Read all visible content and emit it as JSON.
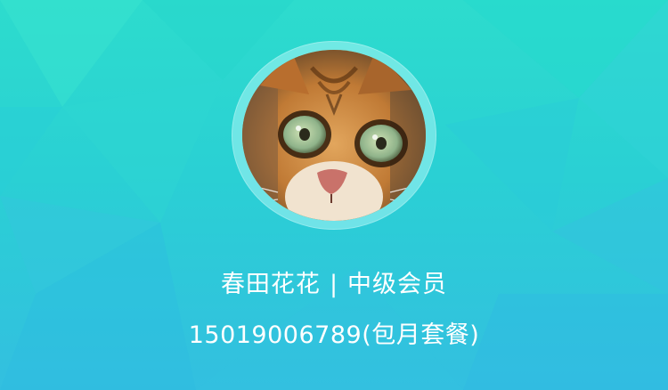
{
  "profile": {
    "nickname": "春田花花",
    "separator": "|",
    "level": "中级会员",
    "phone": "15019006789",
    "plan": "(包月套餐)"
  },
  "avatar": {
    "icon": "cat-avatar-icon"
  },
  "colors": {
    "background_top": "#2ddccd",
    "background_bottom": "#33bfe0",
    "ring": "#aaf5f5",
    "text": "#ffffff"
  }
}
